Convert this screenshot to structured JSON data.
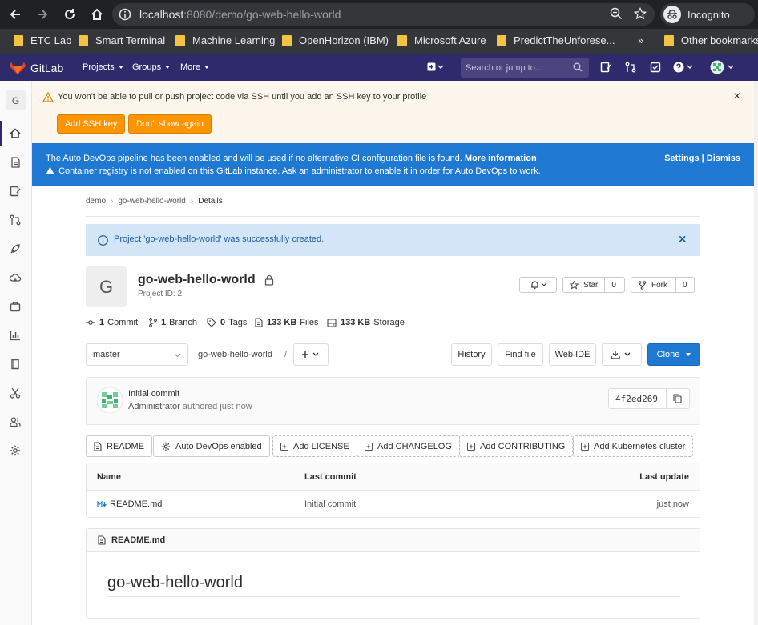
{
  "browser": {
    "url_host": "localhost",
    "url_rest": ":8080/demo/go-web-hello-world",
    "incognito_label": "Incognito",
    "bookmarks": [
      "ETC Lab",
      "Smart Terminal",
      "Machine Learning",
      "OpenHorizon (IBM)",
      "Microsoft Azure",
      "PredictTheUnforese...",
      "Other bookmarks"
    ],
    "more_bookmarks": "»"
  },
  "header": {
    "brand": "GitLab",
    "nav": [
      "Projects",
      "Groups",
      "More"
    ],
    "search_placeholder": "Search or jump to…"
  },
  "sidebar": {
    "avatar_letter": "G"
  },
  "ssh_banner": {
    "message": "You won't be able to pull or push project code via SSH until you add an SSH key to your profile",
    "add_key": "Add SSH key",
    "dont_show": "Don't show again",
    "close": "×"
  },
  "devops_banner": {
    "line1": "The Auto DevOps pipeline has been enabled and will be used if no alternative CI configuration file is found.",
    "more_info": "More information",
    "line2": "Container registry is not enabled on this GitLab instance. Ask an administrator to enable it in order for Auto DevOps to work.",
    "settings": "Settings",
    "pipe": "|",
    "dismiss": "Dismiss"
  },
  "breadcrumb": [
    "demo",
    "go-web-hello-world",
    "Details"
  ],
  "flash": {
    "message": "Project 'go-web-hello-world' was successfully created.",
    "close": "×"
  },
  "project": {
    "avatar_letter": "G",
    "name": "go-web-hello-world",
    "id_label": "Project ID: 2",
    "star_label": "Star",
    "star_count": "0",
    "fork_label": "Fork",
    "fork_count": "0"
  },
  "stats": {
    "commits_n": "1",
    "commits_label": "Commit",
    "branches_n": "1",
    "branches_label": "Branch",
    "tags_n": "0",
    "tags_label": "Tags",
    "files_n": "133 KB",
    "files_label": "Files",
    "storage_n": "133 KB",
    "storage_label": "Storage"
  },
  "tree": {
    "branch": "master",
    "path": "go-web-hello-world",
    "slash": "/",
    "history": "History",
    "find_file": "Find file",
    "web_ide": "Web IDE",
    "clone": "Clone"
  },
  "commit": {
    "title": "Initial commit",
    "author": "Administrator",
    "authored": "authored just now",
    "sha": "4f2ed269"
  },
  "features": [
    "README",
    "Auto DevOps enabled",
    "Add LICENSE",
    "Add CHANGELOG",
    "Add CONTRIBUTING",
    "Add Kubernetes cluster"
  ],
  "files": {
    "headers": [
      "Name",
      "Last commit",
      "Last update"
    ],
    "rows": [
      {
        "name": "README.md",
        "commit": "Initial commit",
        "updated": "just now"
      }
    ]
  },
  "readme": {
    "filename": "README.md",
    "heading": "go-web-hello-world"
  },
  "colors": {
    "header": "#2f2a6b",
    "devops": "#1f78d1",
    "orange": "#fc9403",
    "flash": "#d4e5f7"
  }
}
